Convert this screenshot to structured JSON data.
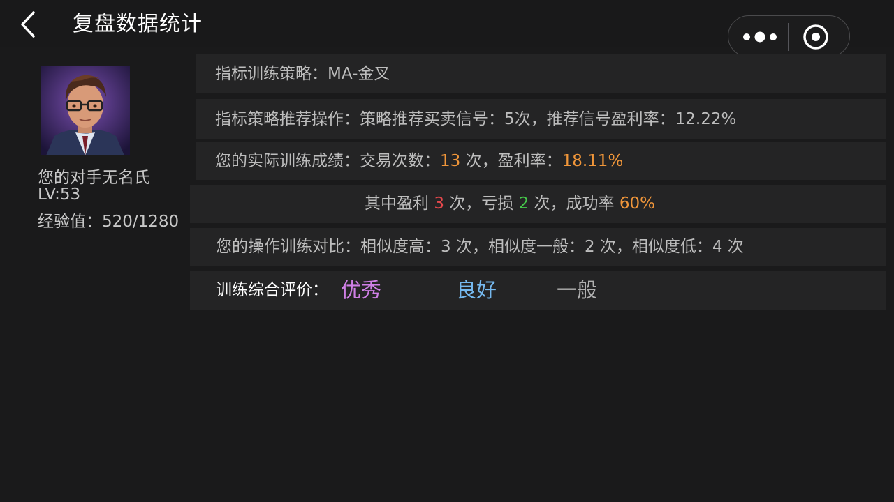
{
  "header": {
    "title": "复盘数据统计"
  },
  "profile": {
    "name": "您的对手无名氏",
    "level": "LV:53",
    "exp": "经验值：520/1280"
  },
  "rows": {
    "strategy": "指标训练策略：MA-金叉",
    "recommend": "指标策略推荐操作：策略推荐买卖信号：5次，推荐信号盈利率：12.22%",
    "actual": {
      "prefix": "您的实际训练成绩：交易次数：",
      "trades": "13",
      "mid": " 次，盈利率：",
      "profit_rate": "18.11%"
    },
    "detail": {
      "prefix": "其中盈利 ",
      "wins": "3",
      "mid1": " 次，亏损 ",
      "losses": "2",
      "mid2": " 次，成功率 ",
      "success_rate": "60%"
    },
    "compare": "您的操作训练对比：相似度高：3 次，相似度一般：2 次，相似度低：4 次",
    "rating": {
      "label": "训练综合评价：",
      "options": [
        "优秀",
        "良好",
        "一般"
      ]
    }
  },
  "colors": {
    "highlight_orange": "#f0963a",
    "win_red": "#e6484c",
    "loss_green": "#46c84a",
    "rating_excellent": "#cf7fe6",
    "rating_good": "#75b8ee",
    "rating_normal": "#b0b0b0"
  },
  "icons": [
    "back-arrow-icon",
    "more-dots-icon",
    "close-target-icon"
  ]
}
